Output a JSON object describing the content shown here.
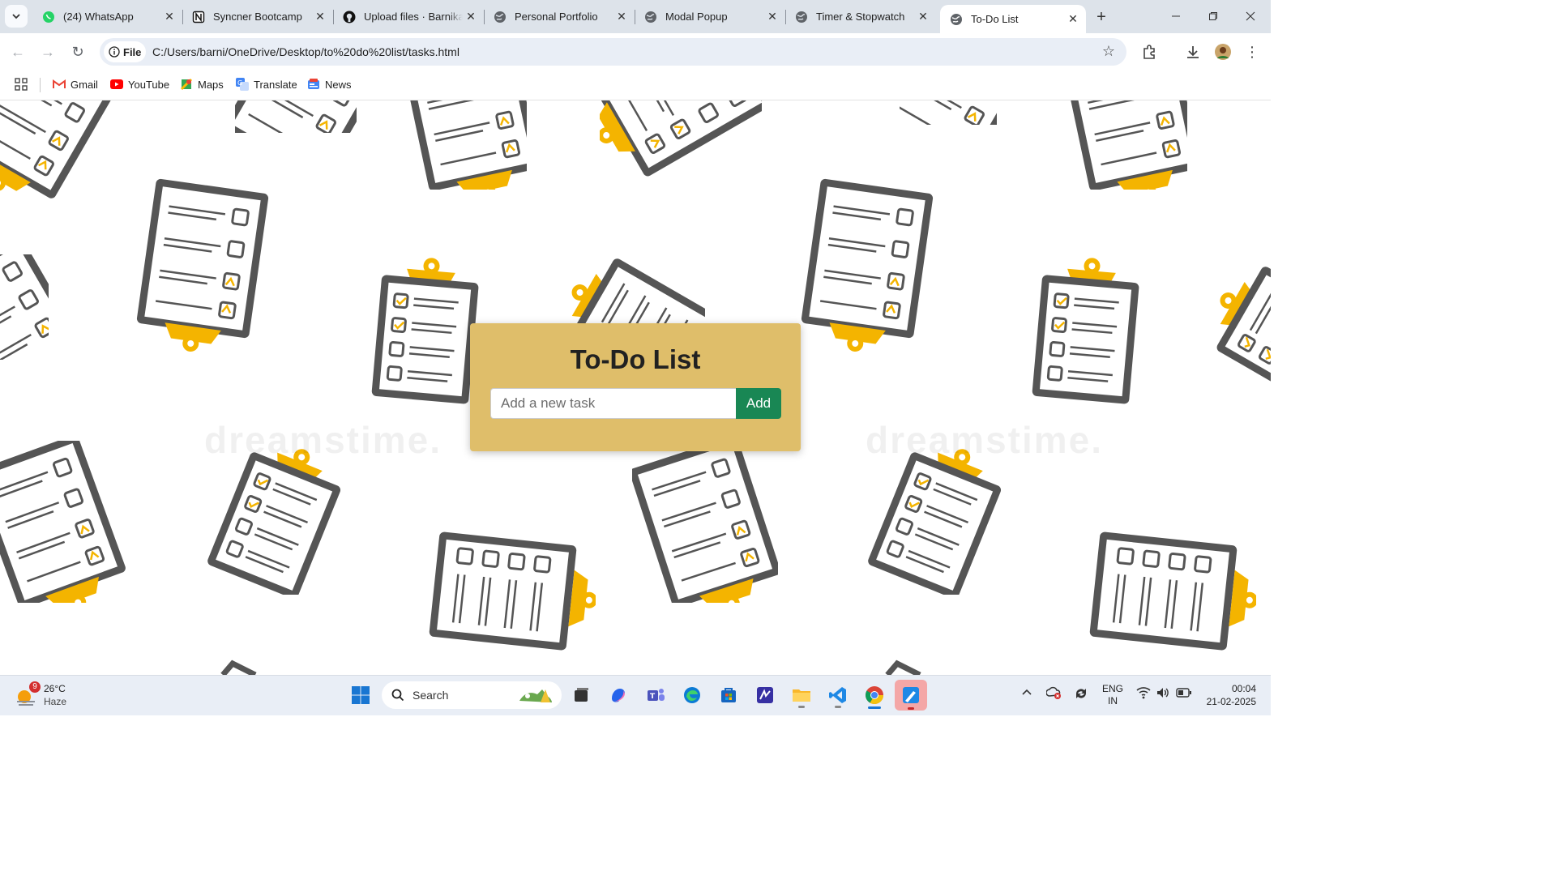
{
  "browser": {
    "tabs": [
      {
        "title": "(24) WhatsApp",
        "icon": "whatsapp-icon"
      },
      {
        "title": "Syncner Bootcamp",
        "icon": "notion-icon"
      },
      {
        "title": "Upload files · Barnika",
        "icon": "github-icon"
      },
      {
        "title": "Personal Portfolio",
        "icon": "globe-icon"
      },
      {
        "title": "Modal Popup",
        "icon": "globe-icon"
      },
      {
        "title": "Timer & Stopwatch",
        "icon": "globe-icon"
      },
      {
        "title": "To-Do List",
        "icon": "globe-icon",
        "active": true
      }
    ],
    "address": {
      "chip_label": "File",
      "url": "C:/Users/barni/OneDrive/Desktop/to%20do%20list/tasks.html"
    },
    "bookmarks": [
      {
        "label": "Gmail",
        "icon": "gmail-icon"
      },
      {
        "label": "YouTube",
        "icon": "youtube-icon"
      },
      {
        "label": "Maps",
        "icon": "maps-icon"
      },
      {
        "label": "Translate",
        "icon": "translate-icon"
      },
      {
        "label": "News",
        "icon": "news-icon"
      }
    ]
  },
  "app": {
    "title": "To-Do List",
    "input_placeholder": "Add a new task",
    "input_value": "",
    "add_label": "Add",
    "watermark": "dreamstime.",
    "colors": {
      "card": "#dfbe6a",
      "button": "#198754",
      "clip_accent": "#f4b400"
    }
  },
  "taskbar": {
    "weather": {
      "temp": "26°C",
      "condition": "Haze",
      "badge": "9"
    },
    "search_label": "Search",
    "lang": {
      "line1": "ENG",
      "line2": "IN"
    },
    "clock": {
      "time": "00:04",
      "date": "21-02-2025"
    }
  }
}
